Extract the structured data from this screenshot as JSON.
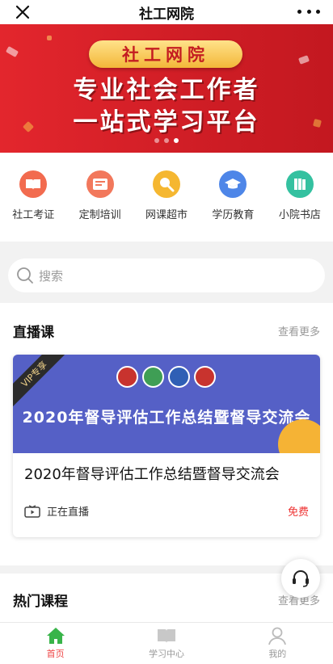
{
  "header": {
    "title": "社工网院",
    "close_icon": "close-icon",
    "more_icon": "more-dots-icon"
  },
  "banner": {
    "badge": "社工网院",
    "line1": "专业社会工作者",
    "line2": "一站式学习平台",
    "slide_index": 3,
    "slide_count": 3
  },
  "nav": {
    "items": [
      {
        "label": "社工考证",
        "icon": "book-icon",
        "color": "#f26b4f"
      },
      {
        "label": "定制培训",
        "icon": "certificate-icon",
        "color": "#f2785c"
      },
      {
        "label": "网课超市",
        "icon": "magnifier-icon",
        "color": "#f5b731"
      },
      {
        "label": "学历教育",
        "icon": "graduation-cap-icon",
        "color": "#4e86e8"
      },
      {
        "label": "小院书店",
        "icon": "books-icon",
        "color": "#34c1a0"
      }
    ]
  },
  "search": {
    "placeholder": "搜索"
  },
  "live": {
    "title": "直播课",
    "more": "查看更多",
    "card": {
      "ribbon": "VIP专享",
      "image_headline": "2020年督导评估工作总结暨督导交流会",
      "title": "2020年督导评估工作总结暨督导交流会",
      "status": "正在直播",
      "price": "免费"
    }
  },
  "hot": {
    "title": "热门课程",
    "more": "查看更多"
  },
  "tabbar": {
    "items": [
      {
        "label": "首页",
        "active": true
      },
      {
        "label": "学习中心",
        "active": false
      },
      {
        "label": "我的",
        "active": false
      }
    ]
  },
  "colors": {
    "accent": "#e44444",
    "banner": "#d9232a",
    "active_tab": "#38b449"
  }
}
